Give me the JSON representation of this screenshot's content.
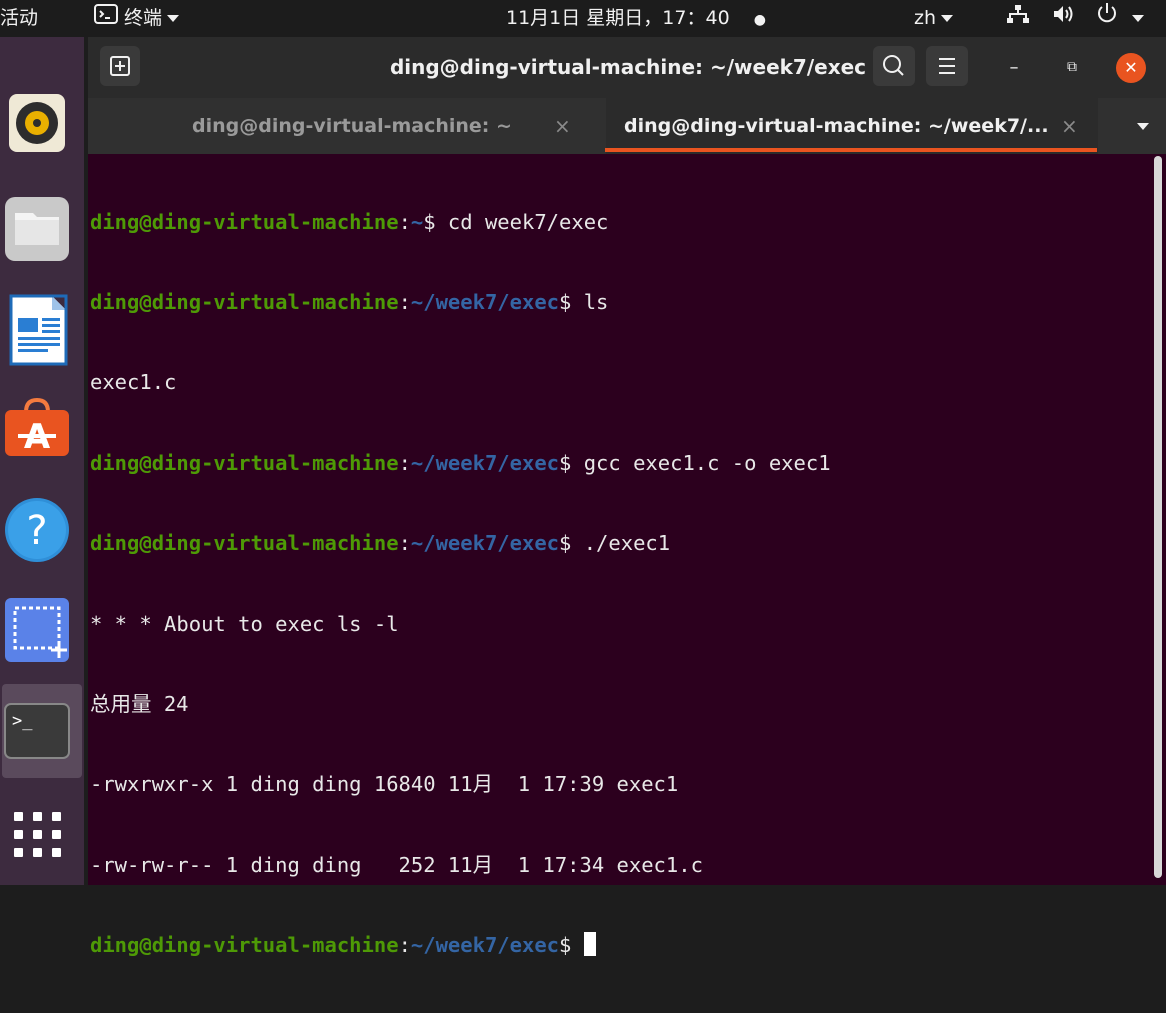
{
  "topbar": {
    "activities": "活动",
    "app_icon": "terminal-icon",
    "app_name": "终端",
    "clock": "11月1日 星期日，17：40",
    "notification_dot": "●",
    "language": "zh",
    "network_icon": "network-icon",
    "volume_icon": "volume-icon",
    "power_icon": "power-icon"
  },
  "dock": {
    "items": [
      {
        "name": "rhythmbox",
        "icon": "music-player-icon"
      },
      {
        "name": "files",
        "icon": "folder-icon"
      },
      {
        "name": "libreoffice-writer",
        "icon": "writer-document-icon"
      },
      {
        "name": "ubuntu-software",
        "icon": "software-store-icon"
      },
      {
        "name": "help",
        "icon": "help-icon",
        "glyph": "?"
      },
      {
        "name": "screenshot",
        "icon": "screenshot-icon"
      },
      {
        "name": "terminal",
        "icon": "terminal-icon",
        "glyph": ">_"
      },
      {
        "name": "show-applications",
        "icon": "app-grid-icon"
      }
    ]
  },
  "window": {
    "title": "ding@ding-virtual-machine: ~/week7/exec",
    "new_tab_icon": "new-tab-icon",
    "search_icon": "search-icon",
    "menu_icon": "hamburger-menu-icon",
    "minimize_glyph": "–",
    "maximize_glyph": "⧉",
    "close_glyph": "✕",
    "tabs": [
      {
        "label": "ding@ding-virtual-machine: ~",
        "close": "×",
        "active": false
      },
      {
        "label": "ding@ding-virtual-machine: ~/week7/...",
        "close": "×",
        "active": true
      }
    ],
    "tab_dropdown_icon": "chevron-down-icon"
  },
  "terminal": {
    "user_host": "ding@ding-virtual-machine",
    "sep": ":",
    "dollar": "$",
    "lines": [
      {
        "path": "~",
        "cmd": " cd week7/exec"
      },
      {
        "path": "~/week7/exec",
        "cmd": " ls"
      },
      {
        "output": "exec1.c"
      },
      {
        "path": "~/week7/exec",
        "cmd": " gcc exec1.c -o exec1"
      },
      {
        "path": "~/week7/exec",
        "cmd": " ./exec1"
      },
      {
        "output": "* * * About to exec ls -l"
      },
      {
        "output": "总用量 24"
      },
      {
        "output": "-rwxrwxr-x 1 ding ding 16840 11月  1 17:39 exec1"
      },
      {
        "output": "-rw-rw-r-- 1 ding ding   252 11月  1 17:34 exec1.c"
      },
      {
        "path": "~/week7/exec",
        "cmd": " ",
        "cursor": true
      }
    ]
  },
  "colors": {
    "terminal_bg": "#2c001e",
    "prompt_user": "#4e9a06",
    "prompt_path": "#3465a4",
    "accent": "#e95420",
    "dock_bg": "#3d2b3f",
    "titlebar_bg": "#2b2b2b"
  }
}
